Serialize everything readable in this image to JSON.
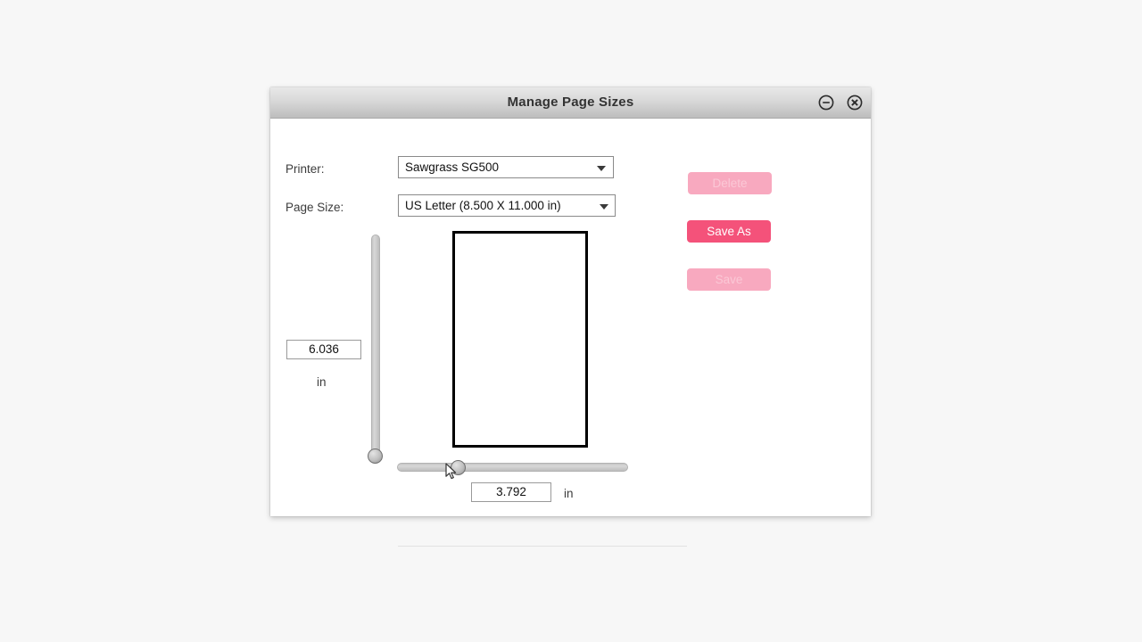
{
  "window": {
    "title": "Manage Page Sizes",
    "minimize_icon": "circle-minus-icon",
    "close_icon": "circle-x-icon"
  },
  "form": {
    "printer": {
      "label": "Printer:",
      "value": "Sawgrass SG500",
      "arrow_icon": "chevron-down-icon"
    },
    "page_size": {
      "label": "Page Size:",
      "value": "US Letter (8.500 X 11.000 in)",
      "arrow_icon": "chevron-down-icon"
    }
  },
  "actions": {
    "delete": {
      "label": "Delete",
      "enabled": false
    },
    "save_as": {
      "label": "Save As",
      "enabled": true
    },
    "save": {
      "label": "Save",
      "enabled": false
    }
  },
  "dimensions": {
    "height": {
      "value": "6.036",
      "unit": "in"
    },
    "width": {
      "value": "3.792",
      "unit": "in"
    }
  },
  "colors": {
    "accent_enabled": "#f4527a",
    "accent_disabled": "#f8a9bf",
    "titlebar_top": "#e8e8e8",
    "titlebar_bottom": "#bdbdbd",
    "page_border": "#000000"
  }
}
